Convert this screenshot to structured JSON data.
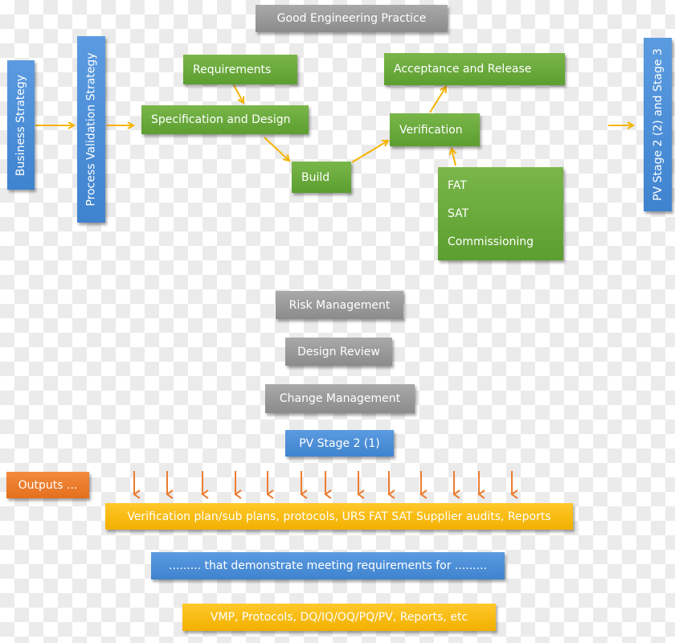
{
  "header": {
    "title": "Good Engineering Practice"
  },
  "strategy": {
    "business": "Business Strategy",
    "process_validation": "Process Validation Strategy"
  },
  "flow": {
    "requirements": "Requirements",
    "specification": "Specification and Design",
    "build": "Build",
    "verification": "Verification",
    "acceptance": "Acceptance and Release",
    "testing_items": [
      "FAT",
      "SAT",
      "Commissioning"
    ],
    "next_stage": "PV Stage 2 (2) and Stage 3"
  },
  "supporting": {
    "risk": "Risk Management",
    "design_review": "Design Review",
    "change": "Change Management",
    "pv_stage_2_1": "PV Stage 2 (1)"
  },
  "outputs": {
    "label": "Outputs ...",
    "arrow_count": 13,
    "deliverables": "Verification plan/sub plans, protocols, URS FAT SAT Supplier audits, Reports",
    "demonstrate": "......... that demonstrate meeting requirements for .........",
    "documents": "VMP, Protocols, DQ/IQ/OQ/PQ/PV, Reports, etc"
  },
  "colors": {
    "gray": "#9a9a9a",
    "green": "#6aaa3a",
    "blue": "#4a8fd8",
    "orange": "#ee7d2e",
    "yellow": "#fbbd10",
    "connector_arrow": "#f5b400",
    "output_arrow": "#ed7d31"
  }
}
